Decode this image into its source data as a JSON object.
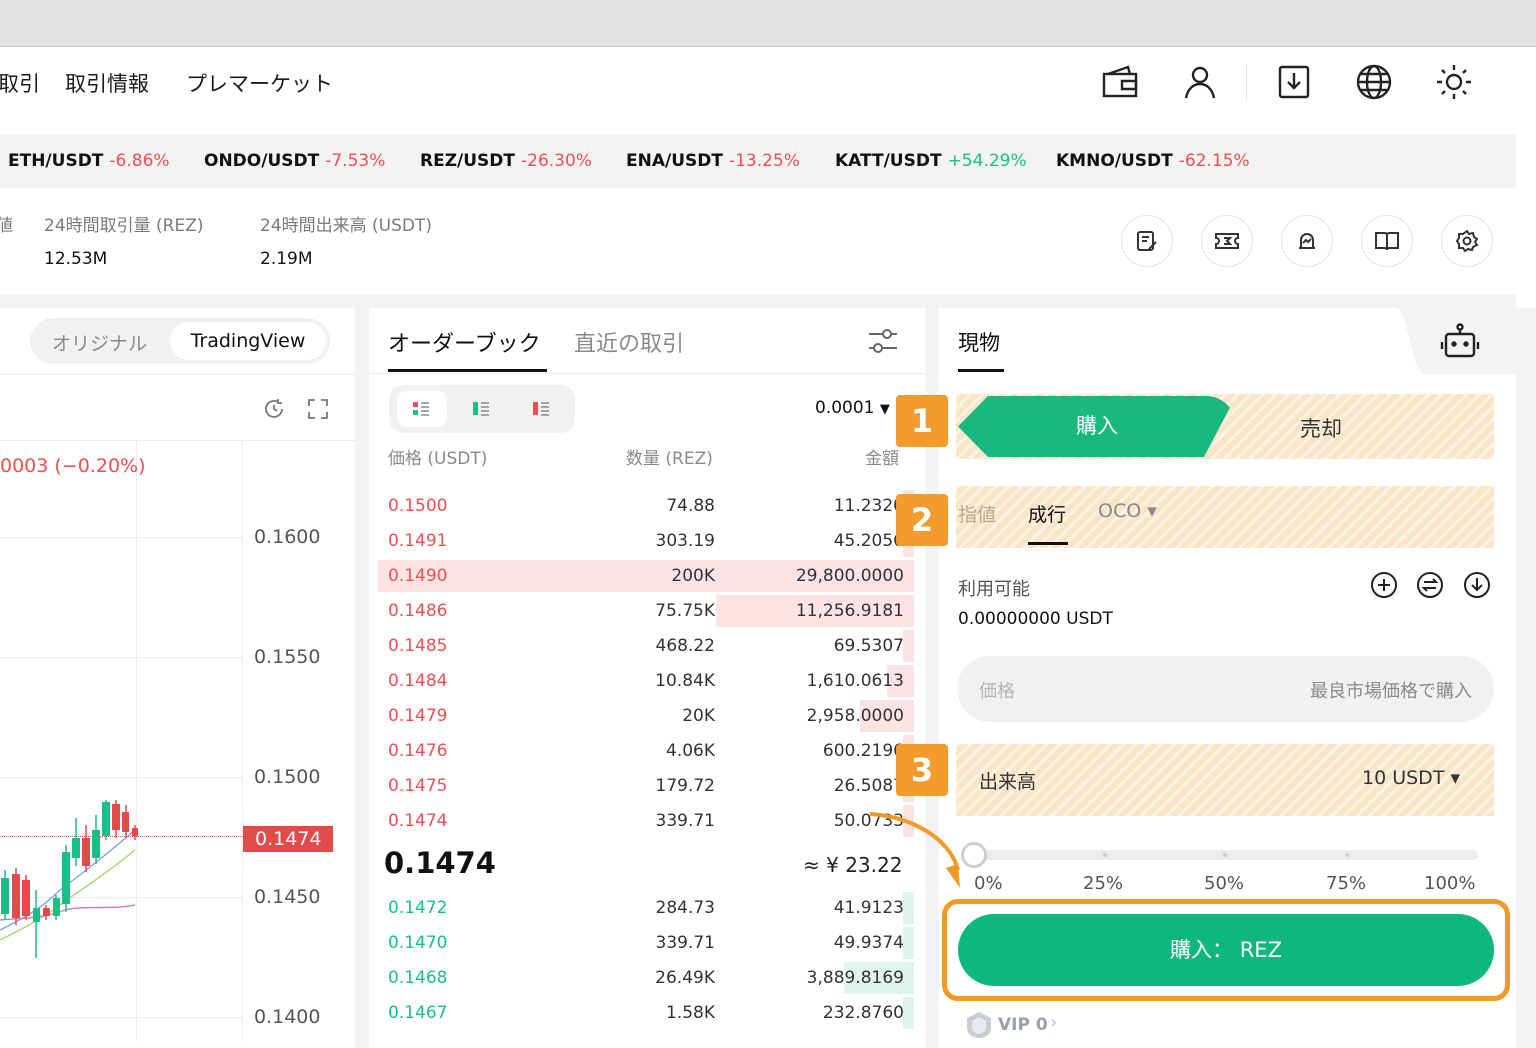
{
  "nav": {
    "items": [
      "取引",
      "取引情報",
      "プレマーケット"
    ]
  },
  "ticker": [
    {
      "pair": "ETH/USDT",
      "change": "-6.86%",
      "dir": "neg"
    },
    {
      "pair": "ONDO/USDT",
      "change": "-7.53%",
      "dir": "neg"
    },
    {
      "pair": "REZ/USDT",
      "change": "-26.30%",
      "dir": "neg"
    },
    {
      "pair": "ENA/USDT",
      "change": "-13.25%",
      "dir": "neg"
    },
    {
      "pair": "KATT/USDT",
      "change": "+54.29%",
      "dir": "pos"
    },
    {
      "pair": "KMNO/USDT",
      "change": "-62.15%",
      "dir": "neg"
    }
  ],
  "stats": {
    "label_cut": "値",
    "vol_rez_label": "24時間取引量 (REZ)",
    "vol_rez_value": "12.53M",
    "vol_usdt_label": "24時間出来高 (USDT)",
    "vol_usdt_value": "2.19M"
  },
  "chart": {
    "toggle_original": "オリジナル",
    "toggle_tradingview": "TradingView",
    "change_text": "0003 (−0.20%)",
    "y_ticks": [
      "0.1600",
      "0.1550",
      "0.1500",
      "0.1450",
      "0.1400"
    ],
    "last_price": "0.1474"
  },
  "orderbook": {
    "tab_orderbook": "オーダーブック",
    "tab_recent": "直近の取引",
    "precision": "0.0001",
    "col_price": "価格 (USDT)",
    "col_qty": "数量 (REZ)",
    "col_total": "金額",
    "asks": [
      {
        "price": "0.1500",
        "qty": "74.88",
        "total": "11.2320",
        "depth": 0.02
      },
      {
        "price": "0.1491",
        "qty": "303.19",
        "total": "45.2056",
        "depth": 0.02
      },
      {
        "price": "0.1490",
        "qty": "200K",
        "total": "29,800.0000",
        "depth": 1.0
      },
      {
        "price": "0.1486",
        "qty": "75.75K",
        "total": "11,256.9181",
        "depth": 0.37
      },
      {
        "price": "0.1485",
        "qty": "468.22",
        "total": "69.5307",
        "depth": 0.01
      },
      {
        "price": "0.1484",
        "qty": "10.84K",
        "total": "1,610.0613",
        "depth": 0.05
      },
      {
        "price": "0.1479",
        "qty": "20K",
        "total": "2,958.0000",
        "depth": 0.1
      },
      {
        "price": "0.1476",
        "qty": "4.06K",
        "total": "600.2196",
        "depth": 0.02
      },
      {
        "price": "0.1475",
        "qty": "179.72",
        "total": "26.5087",
        "depth": 0.01
      },
      {
        "price": "0.1474",
        "qty": "339.71",
        "total": "50.0733",
        "depth": 0.01
      }
    ],
    "mid_price": "0.1474",
    "mid_fiat": "≈ ¥ 23.22",
    "bids": [
      {
        "price": "0.1472",
        "qty": "284.73",
        "total": "41.9123",
        "depth": 0.01
      },
      {
        "price": "0.1470",
        "qty": "339.71",
        "total": "49.9374",
        "depth": 0.01
      },
      {
        "price": "0.1468",
        "qty": "26.49K",
        "total": "3,889.8169",
        "depth": 0.13
      },
      {
        "price": "0.1467",
        "qty": "1.58K",
        "total": "232.8760",
        "depth": 0.02
      }
    ]
  },
  "trade": {
    "tab_spot": "現物",
    "buy": "購入",
    "sell": "売却",
    "order_limit": "指値",
    "order_market": "成行",
    "order_oco": "OCO ▾",
    "available_label": "利用可能",
    "available_value": "0.00000000 USDT",
    "price_placeholder": "価格",
    "price_hint": "最良市場価格で購入",
    "volume_label": "出来高",
    "volume_value": "10 USDT ▾",
    "slider_ticks": [
      "0%",
      "25%",
      "50%",
      "75%",
      "100%"
    ],
    "slider_level": 0,
    "buy_button": "購入： REZ",
    "vip": "VIP 0",
    "vip_chevron": "›"
  },
  "badges": [
    "1",
    "2",
    "3"
  ],
  "colors": {
    "green": "#19b87f",
    "red": "#f24e4e",
    "highlight": "#f39c2b"
  }
}
